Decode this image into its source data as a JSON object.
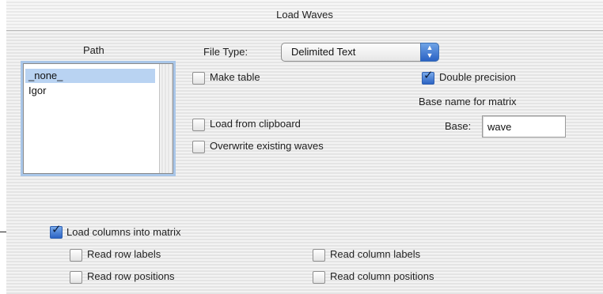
{
  "window": {
    "title": "Load Waves"
  },
  "path": {
    "label": "Path",
    "items": [
      {
        "label": "_none_",
        "selected": true
      },
      {
        "label": "Igor",
        "selected": false
      }
    ]
  },
  "file_type": {
    "label": "File Type:",
    "value": "Delimited Text"
  },
  "options": {
    "make_table": {
      "label": "Make table",
      "checked": false
    },
    "double_precision": {
      "label": "Double precision",
      "checked": true
    },
    "load_from_clipboard": {
      "label": "Load from clipboard",
      "checked": false
    },
    "overwrite_existing": {
      "label": "Overwrite existing waves",
      "checked": false
    }
  },
  "matrix": {
    "heading": "Base name for matrix",
    "base_label": "Base:",
    "base_value": "wave"
  },
  "load_columns": {
    "main": {
      "label": "Load columns into matrix",
      "checked": true
    },
    "read_row_labels": {
      "label": "Read row labels",
      "checked": false
    },
    "read_column_labels": {
      "label": "Read column labels",
      "checked": false
    },
    "read_row_positions": {
      "label": "Read row positions",
      "checked": false
    },
    "read_column_positions": {
      "label": "Read column positions",
      "checked": false
    }
  },
  "colors": {
    "accent": "#2c63c3",
    "selection": "#b9d3f2"
  },
  "icons": {
    "popup": "up-down-arrows-icon",
    "checkmark": "checkmark-icon"
  }
}
